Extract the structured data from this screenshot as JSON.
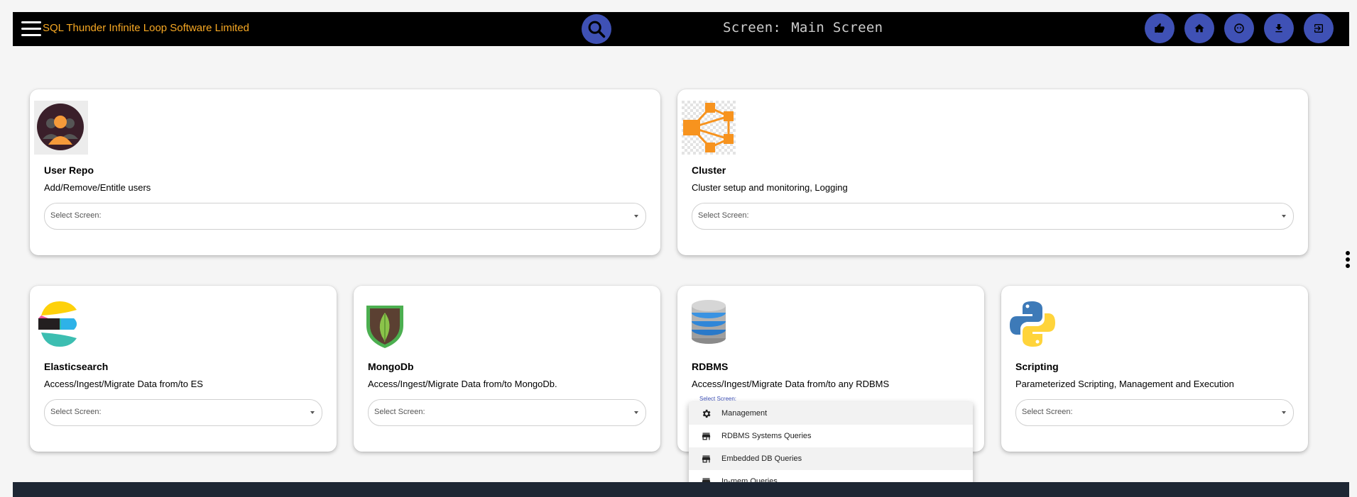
{
  "header": {
    "brand": "SQL Thunder Infinite Loop Software Limited",
    "screen_label": "Screen:",
    "screen_name": "Main Screen"
  },
  "cards": [
    {
      "title": "User Repo",
      "desc": "Add/Remove/Entitle users",
      "select_placeholder": "Select Screen:",
      "icon": "user-repo-icon"
    },
    {
      "title": "Cluster",
      "desc": "Cluster setup and monitoring, Logging",
      "select_placeholder": "Select Screen:",
      "icon": "cluster-icon"
    },
    {
      "title": "Elasticsearch",
      "desc": "Access/Ingest/Migrate Data from/to ES",
      "select_placeholder": "Select Screen:",
      "icon": "elasticsearch-icon"
    },
    {
      "title": "MongoDb",
      "desc": "Access/Ingest/Migrate Data from/to MongoDb.",
      "select_placeholder": "Select Screen:",
      "icon": "mongodb-icon"
    },
    {
      "title": "RDBMS",
      "desc": "Access/Ingest/Migrate Data from/to any RDBMS",
      "select_placeholder": "Select Screen:",
      "icon": "database-icon"
    },
    {
      "title": "Scripting",
      "desc": "Parameterized Scripting, Management and Execution",
      "select_placeholder": "Select Screen:",
      "icon": "python-icon"
    }
  ],
  "rdbms_menu": {
    "items": [
      {
        "label": "Management",
        "icon": "gear-icon"
      },
      {
        "label": "RDBMS Systems Queries",
        "icon": "store-icon"
      },
      {
        "label": "Embedded DB Queries",
        "icon": "store-icon"
      },
      {
        "label": "In-mem Queries",
        "icon": "store-icon"
      }
    ]
  },
  "colors": {
    "topbar": "#000000",
    "brand": "#f7a823",
    "accent": "#3f51b5",
    "footer": "#1e2734"
  }
}
